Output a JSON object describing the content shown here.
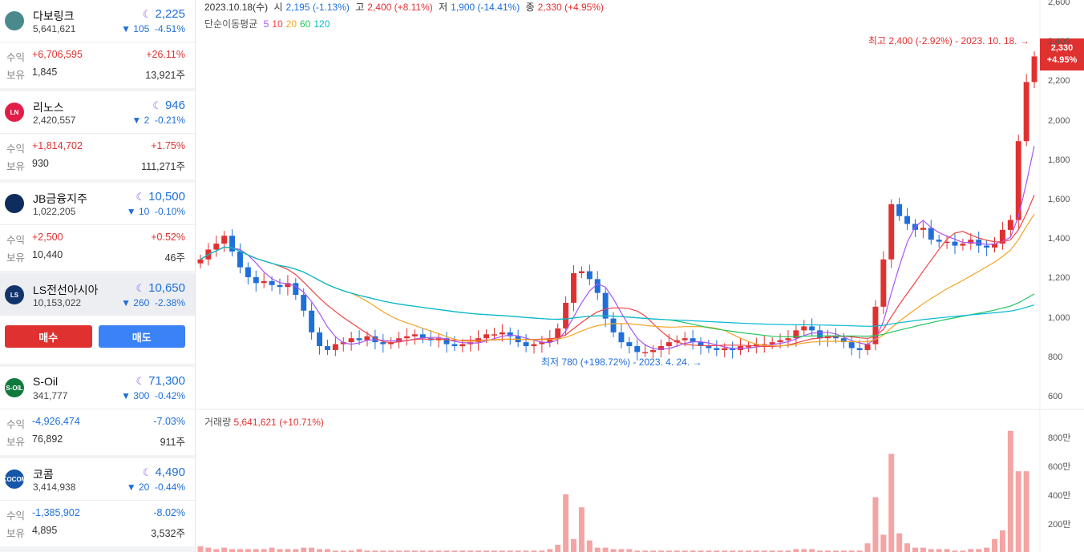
{
  "sidebar": {
    "stocks": [
      {
        "name": "다보링크",
        "volume": "5,641,621",
        "price": "2,225",
        "change_amt": "▼ 105",
        "change_pct": "-4.51%",
        "profit_label": "수익",
        "profit": "+6,706,595",
        "profit_pct": "+26.11%",
        "hold_label": "보유",
        "hold_qty": "1,845",
        "hold_shares": "13,921주",
        "profit_color": "red",
        "logo_color": "#4a8a8c",
        "logo_text": ""
      },
      {
        "name": "리노스",
        "volume": "2,420,557",
        "price": "946",
        "change_amt": "▼ 2",
        "change_pct": "-0.21%",
        "profit_label": "수익",
        "profit": "+1,814,702",
        "profit_pct": "+1.75%",
        "hold_label": "보유",
        "hold_qty": "930",
        "hold_shares": "111,271주",
        "profit_color": "red",
        "logo_color": "#e11d48",
        "logo_text": "LN"
      },
      {
        "name": "JB금융지주",
        "volume": "1,022,205",
        "price": "10,500",
        "change_amt": "▼ 10",
        "change_pct": "-0.10%",
        "profit_label": "수익",
        "profit": "+2,500",
        "profit_pct": "+0.52%",
        "hold_label": "보유",
        "hold_qty": "10,440",
        "hold_shares": "46주",
        "profit_color": "red",
        "logo_color": "#0f2d5c",
        "logo_text": ""
      },
      {
        "name": "LS전선아시아",
        "volume": "10,153,022",
        "price": "10,650",
        "change_amt": "▼ 260",
        "change_pct": "-2.38%",
        "profit_label": "",
        "profit": "",
        "profit_pct": "",
        "hold_label": "",
        "hold_qty": "",
        "hold_shares": "",
        "profit_color": "red",
        "logo_color": "#13346b",
        "logo_text": "LS"
      },
      {
        "name": "S-Oil",
        "volume": "341,777",
        "price": "71,300",
        "change_amt": "▼ 300",
        "change_pct": "-0.42%",
        "profit_label": "수익",
        "profit": "-4,926,474",
        "profit_pct": "-7.03%",
        "hold_label": "보유",
        "hold_qty": "76,892",
        "hold_shares": "911주",
        "profit_color": "blue",
        "logo_color": "#0f7a3c",
        "logo_text": "S-OIL"
      },
      {
        "name": "코콤",
        "volume": "3,414,938",
        "price": "4,490",
        "change_amt": "▼ 20",
        "change_pct": "-0.44%",
        "profit_label": "수익",
        "profit": "-1,385,902",
        "profit_pct": "-8.02%",
        "hold_label": "보유",
        "hold_qty": "4,895",
        "hold_shares": "3,532주",
        "profit_color": "blue",
        "logo_color": "#1656a8",
        "logo_text": "KOCOM"
      }
    ],
    "buy_label": "매수",
    "sell_label": "매도"
  },
  "chart": {
    "date": "2023.10.18(수)",
    "open_label": "시",
    "open": "2,195 (-1.13%)",
    "high_label": "고",
    "high": "2,400 (+8.11%)",
    "low_label": "저",
    "low": "1,900 (-14.41%)",
    "close_label": "종",
    "close": "2,330 (+4.95%)",
    "ma_label": "단순이동평균",
    "ma_periods": [
      "5",
      "10",
      "20",
      "60",
      "120"
    ],
    "ma_colors": [
      "#a855f7",
      "#ef4444",
      "#f5a524",
      "#22c55e",
      "#06b6d4"
    ],
    "volume_label": "거래량",
    "volume_value": "5,641,621 (+10.71%)",
    "max_annotation": "최고 2,400 (-2.92%) - 2023. 10. 18. →",
    "min_annotation": "최저 780 (+198.72%) - 2023. 4. 24. →",
    "last_price": "2,330",
    "last_pct": "+4.95%",
    "up_color": "#e03131",
    "down_color": "#1e6fd9"
  },
  "chart_data": {
    "type": "candlestick",
    "price_axis": {
      "ticks": [
        "2,600",
        "2,400",
        "2,200",
        "2,000",
        "1,800",
        "1,600",
        "1,400",
        "1,200",
        "1,000",
        "800",
        "600"
      ],
      "min": 600,
      "max": 2600
    },
    "volume_axis": {
      "ticks": [
        "800만",
        "600만",
        "400만",
        "200만"
      ],
      "max_millions": 8
    },
    "close_series": [
      1300,
      1350,
      1380,
      1420,
      1340,
      1260,
      1210,
      1180,
      1190,
      1170,
      1160,
      1180,
      1120,
      1040,
      930,
      860,
      840,
      870,
      880,
      900,
      890,
      910,
      880,
      870,
      880,
      900,
      910,
      920,
      900,
      890,
      900,
      870,
      860,
      870,
      880,
      900,
      920,
      920,
      930,
      910,
      880,
      860,
      870,
      880,
      900,
      950,
      1080,
      1230,
      1240,
      1200,
      1130,
      1000,
      930,
      880,
      860,
      830,
      830,
      840,
      860,
      880,
      890,
      900,
      880,
      860,
      850,
      840,
      850,
      840,
      860,
      860,
      870,
      870,
      880,
      890,
      900,
      940,
      960,
      940,
      900,
      910,
      900,
      880,
      850,
      840,
      870,
      1060,
      1300,
      1580,
      1520,
      1480,
      1450,
      1460,
      1400,
      1390,
      1390,
      1370,
      1380,
      1400,
      1370,
      1360,
      1380,
      1450,
      1500,
      1900,
      2200,
      2330
    ],
    "volume_millions": [
      0.4,
      0.3,
      0.2,
      0.3,
      0.2,
      0.2,
      0.2,
      0.2,
      0.2,
      0.3,
      0.2,
      0.2,
      0.2,
      0.3,
      0.3,
      0.2,
      0.2,
      0.1,
      0.1,
      0.1,
      0.2,
      0.1,
      0.1,
      0.1,
      0.1,
      0.1,
      0.1,
      0.1,
      0.1,
      0.1,
      0.1,
      0.1,
      0.1,
      0.1,
      0.1,
      0.1,
      0.1,
      0.1,
      0.1,
      0.1,
      0.1,
      0.1,
      0.1,
      0.1,
      0.2,
      0.5,
      4.0,
      0.9,
      3.1,
      0.8,
      0.3,
      0.3,
      0.2,
      0.2,
      0.2,
      0.1,
      0.1,
      0.1,
      0.1,
      0.1,
      0.1,
      0.1,
      0.1,
      0.1,
      0.1,
      0.1,
      0.1,
      0.1,
      0.1,
      0.1,
      0.1,
      0.1,
      0.1,
      0.1,
      0.1,
      0.2,
      0.2,
      0.2,
      0.1,
      0.1,
      0.1,
      0.1,
      0.1,
      0.1,
      0.6,
      3.8,
      1.2,
      6.8,
      1.3,
      0.6,
      0.3,
      0.3,
      0.2,
      0.2,
      0.2,
      0.1,
      0.1,
      0.2,
      0.2,
      0.3,
      0.9,
      1.5,
      8.4,
      5.6,
      5.6
    ]
  }
}
